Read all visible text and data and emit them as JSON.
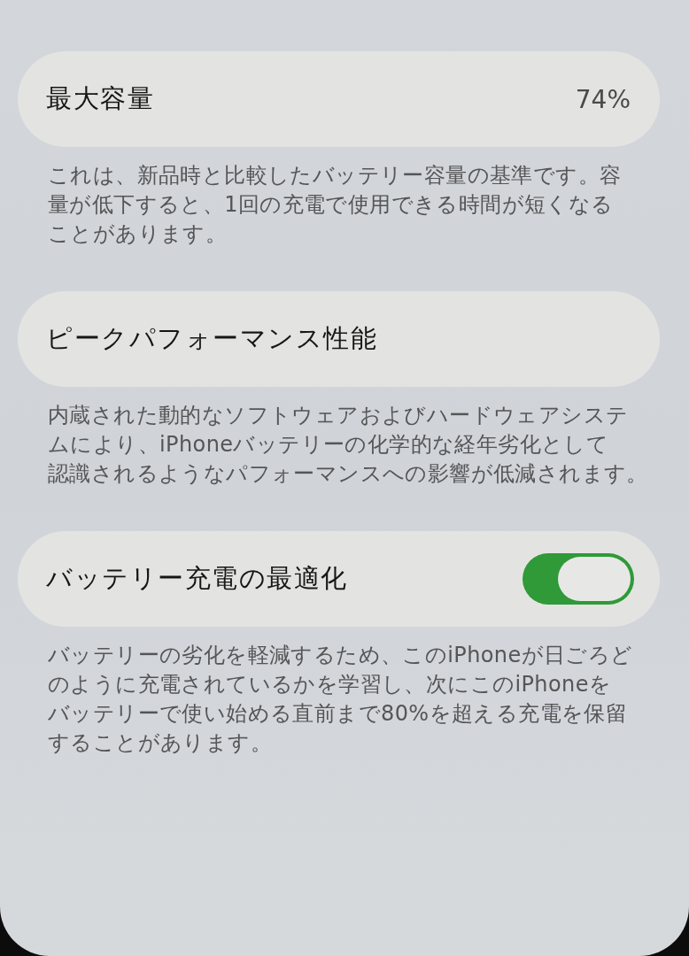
{
  "sections": [
    {
      "kind": "value",
      "title": "最大容量",
      "value": "74%",
      "description": [
        "これは、新品時と比較したバッテリー容量の基準です。容",
        "量が低下すると、1回の充電で使用できる時間が短くなる",
        "ことがあります。"
      ]
    },
    {
      "kind": "plain",
      "title": "ピークパフォーマンス性能",
      "description": [
        "内蔵された動的なソフトウェアおよびハードウェアシステ",
        "ムにより、iPhoneバッテリーの化学的な経年劣化として",
        "認識されるようなパフォーマンスへの影響が低減されます。"
      ]
    },
    {
      "kind": "toggle",
      "title": "バッテリー充電の最適化",
      "on": true,
      "description": [
        "バッテリーの劣化を軽減するため、このiPhoneが日ごろど",
        "のように充電されているかを学習し、次にこのiPhoneを",
        "バッテリーで使い始める直前まで80%を超える充電を保留",
        "することがあります。"
      ]
    }
  ]
}
